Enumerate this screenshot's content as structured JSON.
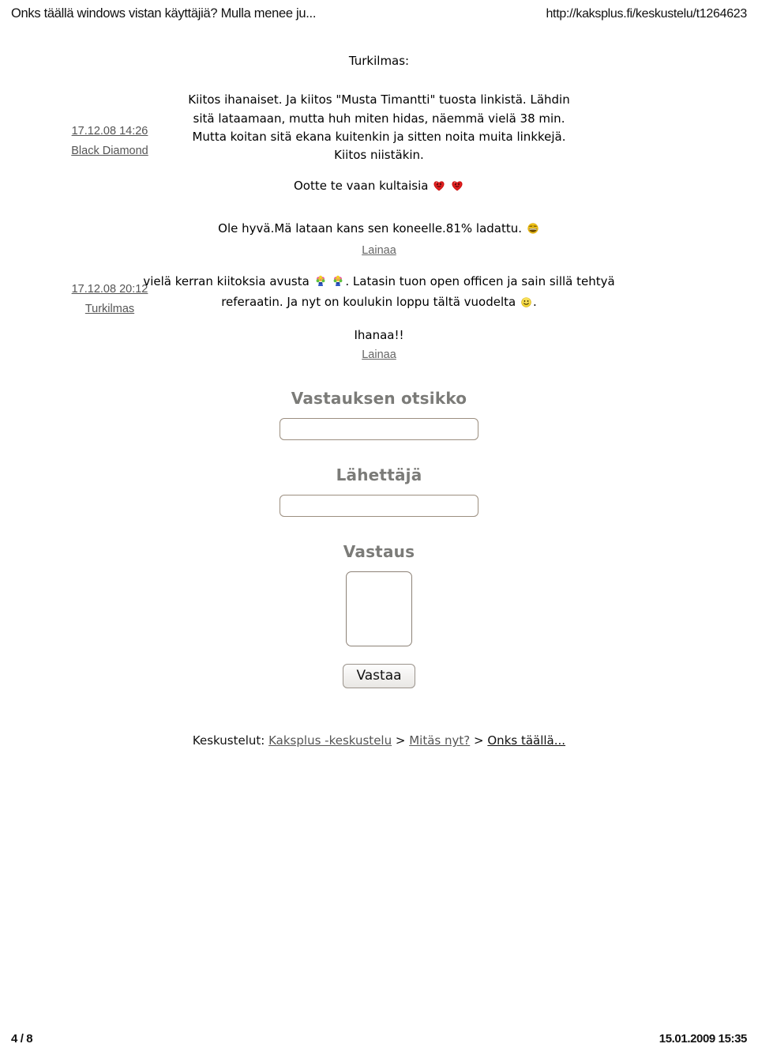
{
  "print_header": {
    "title": "Onks täällä windows vistan käyttäjiä? Mulla menee ju...",
    "url": "http://kaksplus.fi/keskustelu/t1264623"
  },
  "print_footer": {
    "page": "4 / 8",
    "printed_at": "15.01.2009 15:35"
  },
  "posts": [
    {
      "meta": {
        "timestamp": "17.12.08 14:26",
        "author": "Black Diamond"
      },
      "quoted_poster": "Turkilmas:",
      "paragraphs": [
        "Kiitos ihanaiset. Ja kiitos \"Musta Timantti\" tuosta linkistä. Lähdin sitä lataamaan, mutta huh miten hidas, näemmä vielä 38 min. Mutta koitan sitä ekana kuitenkin ja sitten noita muita linkkejä. Kiitos niistäkin.",
        "Ootte te vaan kultaisia"
      ],
      "emoji_after_last": [
        "heart-face",
        "heart-face"
      ]
    },
    {
      "meta": {
        "timestamp": "17.12.08 20:12",
        "author": "Turkilmas"
      },
      "line_1": "Ole hyvä.Mä lataan kans sen koneelle.81% ladattu.",
      "line_1_emoji": "grin-face",
      "quote_link_1": "Lainaa",
      "body_part_1": "vielä kerran kiitoksia avusta",
      "body_emoji": [
        "bouquet",
        "bouquet"
      ],
      "body_part_2": ". Latasin tuon open officen ja sain sillä tehtyä referaatin. Ja nyt on koulukin loppu tältä vuodelta",
      "body_part_2_emoji": "smiley",
      "body_part_3": ".",
      "line_3": "Ihanaa!!",
      "quote_link_2": "Lainaa"
    }
  ],
  "reply_form": {
    "subject_label": "Vastauksen otsikko",
    "subject_value": "",
    "subject_placeholder": "",
    "sender_label": "Lähettäjä",
    "sender_value": "",
    "sender_placeholder": "",
    "message_label": "Vastaus",
    "message_value": "",
    "message_placeholder": "",
    "submit_label": "Vastaa"
  },
  "breadcrumb": {
    "prefix": "Keskustelut:",
    "items": [
      {
        "label": "Kaksplus -keskustelu",
        "current": false
      },
      {
        "label": "Mitäs nyt?",
        "current": false
      },
      {
        "label": "Onks täällä...",
        "current": true
      }
    ],
    "separator": ">"
  },
  "colors": {
    "form_label": "#7b7b78",
    "input_border": "#9c8f80",
    "link": "#555555",
    "text": "#000000"
  }
}
